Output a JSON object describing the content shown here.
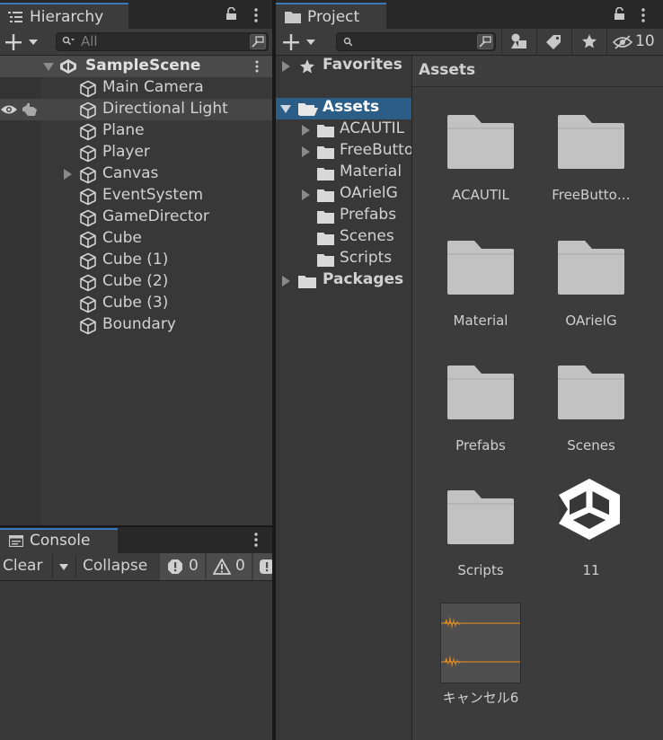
{
  "hierarchy": {
    "tab_label": "Hierarchy",
    "search_placeholder": "All",
    "scene_name": "SampleScene",
    "items": [
      {
        "label": "Main Camera",
        "expandable": false
      },
      {
        "label": "Directional Light",
        "expandable": false
      },
      {
        "label": "Plane",
        "expandable": false
      },
      {
        "label": "Player",
        "expandable": false
      },
      {
        "label": "Canvas",
        "expandable": true
      },
      {
        "label": "EventSystem",
        "expandable": false
      },
      {
        "label": "GameDirector",
        "expandable": false
      },
      {
        "label": "Cube",
        "expandable": false
      },
      {
        "label": "Cube (1)",
        "expandable": false
      },
      {
        "label": "Cube (2)",
        "expandable": false
      },
      {
        "label": "Cube (3)",
        "expandable": false
      },
      {
        "label": "Boundary",
        "expandable": false
      }
    ]
  },
  "console": {
    "tab_label": "Console",
    "clear_label": "Clear",
    "collapse_label": "Collapse",
    "error_count": "0",
    "warning_count": "0"
  },
  "project": {
    "tab_label": "Project",
    "hidden_count": "10",
    "tree": {
      "favorites": "Favorites",
      "assets": "Assets",
      "asset_folders": [
        {
          "label": "ACAUTIL",
          "expandable": true
        },
        {
          "label": "FreeButto",
          "expandable": true
        },
        {
          "label": "Material",
          "expandable": false
        },
        {
          "label": "OArielG",
          "expandable": true
        },
        {
          "label": "Prefabs",
          "expandable": false
        },
        {
          "label": "Scenes",
          "expandable": false
        },
        {
          "label": "Scripts",
          "expandable": false
        }
      ],
      "packages": "Packages"
    },
    "breadcrumb": "Assets",
    "grid": [
      {
        "label": "ACAUTIL",
        "kind": "folder"
      },
      {
        "label": "FreeButto…",
        "kind": "folder"
      },
      {
        "label": "Material",
        "kind": "folder"
      },
      {
        "label": "OArielG",
        "kind": "folder"
      },
      {
        "label": "Prefabs",
        "kind": "folder"
      },
      {
        "label": "Scenes",
        "kind": "folder"
      },
      {
        "label": "Scripts",
        "kind": "folder"
      },
      {
        "label": "11",
        "kind": "unity-scene"
      },
      {
        "label": "キャンセル6",
        "kind": "audio"
      }
    ]
  },
  "colors": {
    "accent": "#3a79bb",
    "selection": "#2c5d87",
    "panel": "#383838",
    "waveform": "#f0901c"
  }
}
